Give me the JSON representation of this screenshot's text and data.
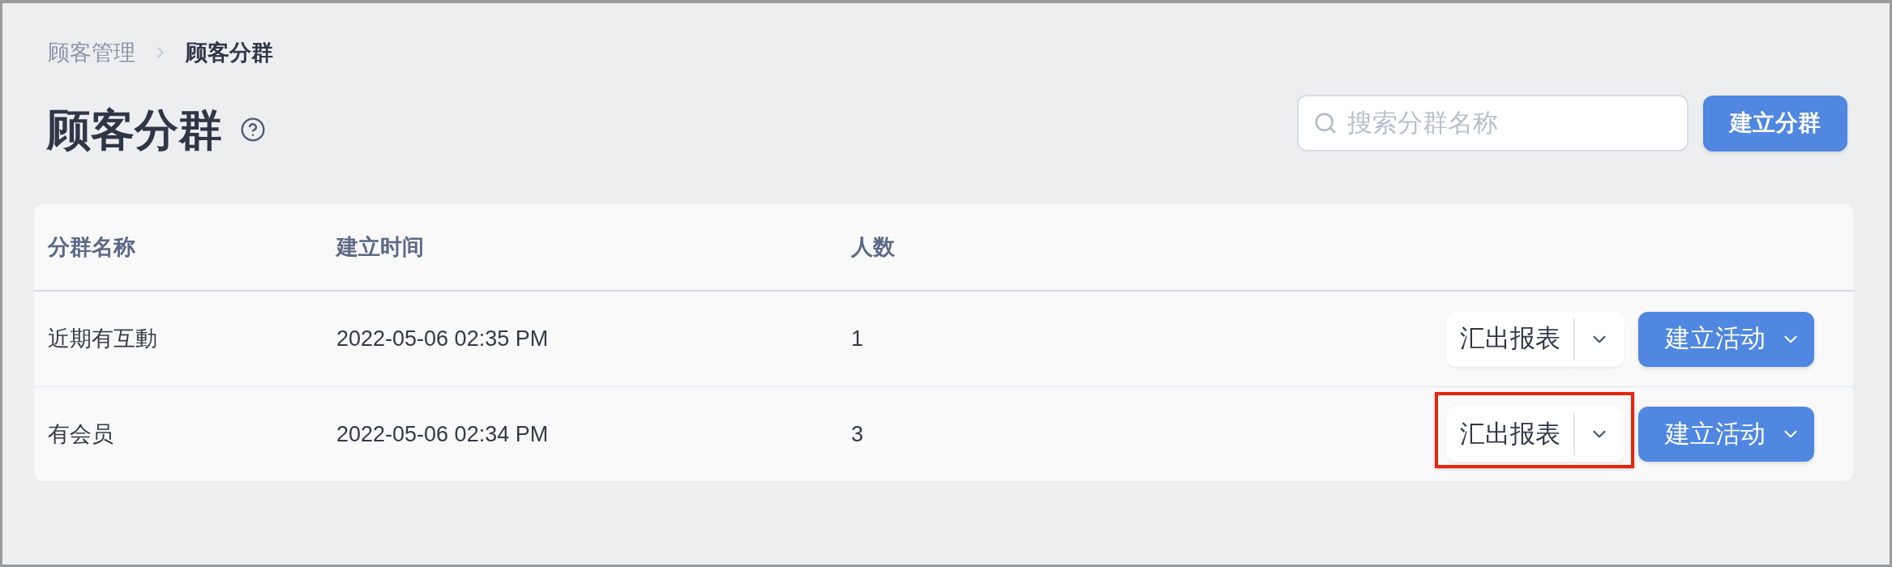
{
  "breadcrumb": [
    {
      "label": "顾客管理",
      "current": false
    },
    {
      "label": "顾客分群",
      "current": true
    }
  ],
  "page": {
    "title": "顾客分群"
  },
  "search": {
    "placeholder": "搜索分群名称"
  },
  "create_button": {
    "label": "建立分群"
  },
  "table": {
    "columns": [
      "分群名称",
      "建立时间",
      "人数"
    ],
    "rows": [
      {
        "name": "近期有互動",
        "created": "2022-05-06 02:35 PM",
        "count": "1",
        "export_label": "汇出报表",
        "activity_label": "建立活动",
        "highlighted": false
      },
      {
        "name": "有会员",
        "created": "2022-05-06 02:34 PM",
        "count": "3",
        "export_label": "汇出报表",
        "activity_label": "建立活动",
        "highlighted": true
      }
    ]
  }
}
